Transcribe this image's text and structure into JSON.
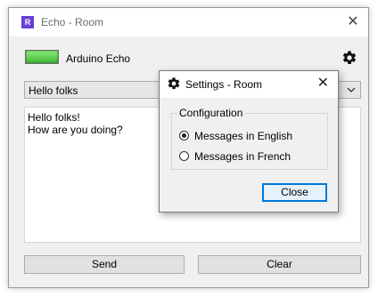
{
  "window": {
    "app_icon_letter": "R",
    "title": "Echo - Room",
    "close_glyph": "✕"
  },
  "device": {
    "status_led_color": "#3eb535",
    "label": "Arduino Echo",
    "settings_icon": "gear-icon"
  },
  "message_combo": {
    "selected": "Hello folks"
  },
  "output": {
    "text": "Hello folks!\nHow are you doing?"
  },
  "buttons": {
    "send": "Send",
    "clear": "Clear"
  },
  "settings_dialog": {
    "title": "Settings - Room",
    "close_glyph": "✕",
    "group_label": "Configuration",
    "options": [
      {
        "label": "Messages in English",
        "selected": true
      },
      {
        "label": "Messages in French",
        "selected": false
      }
    ],
    "close_button": "Close",
    "accent_color": "#0078d7"
  }
}
